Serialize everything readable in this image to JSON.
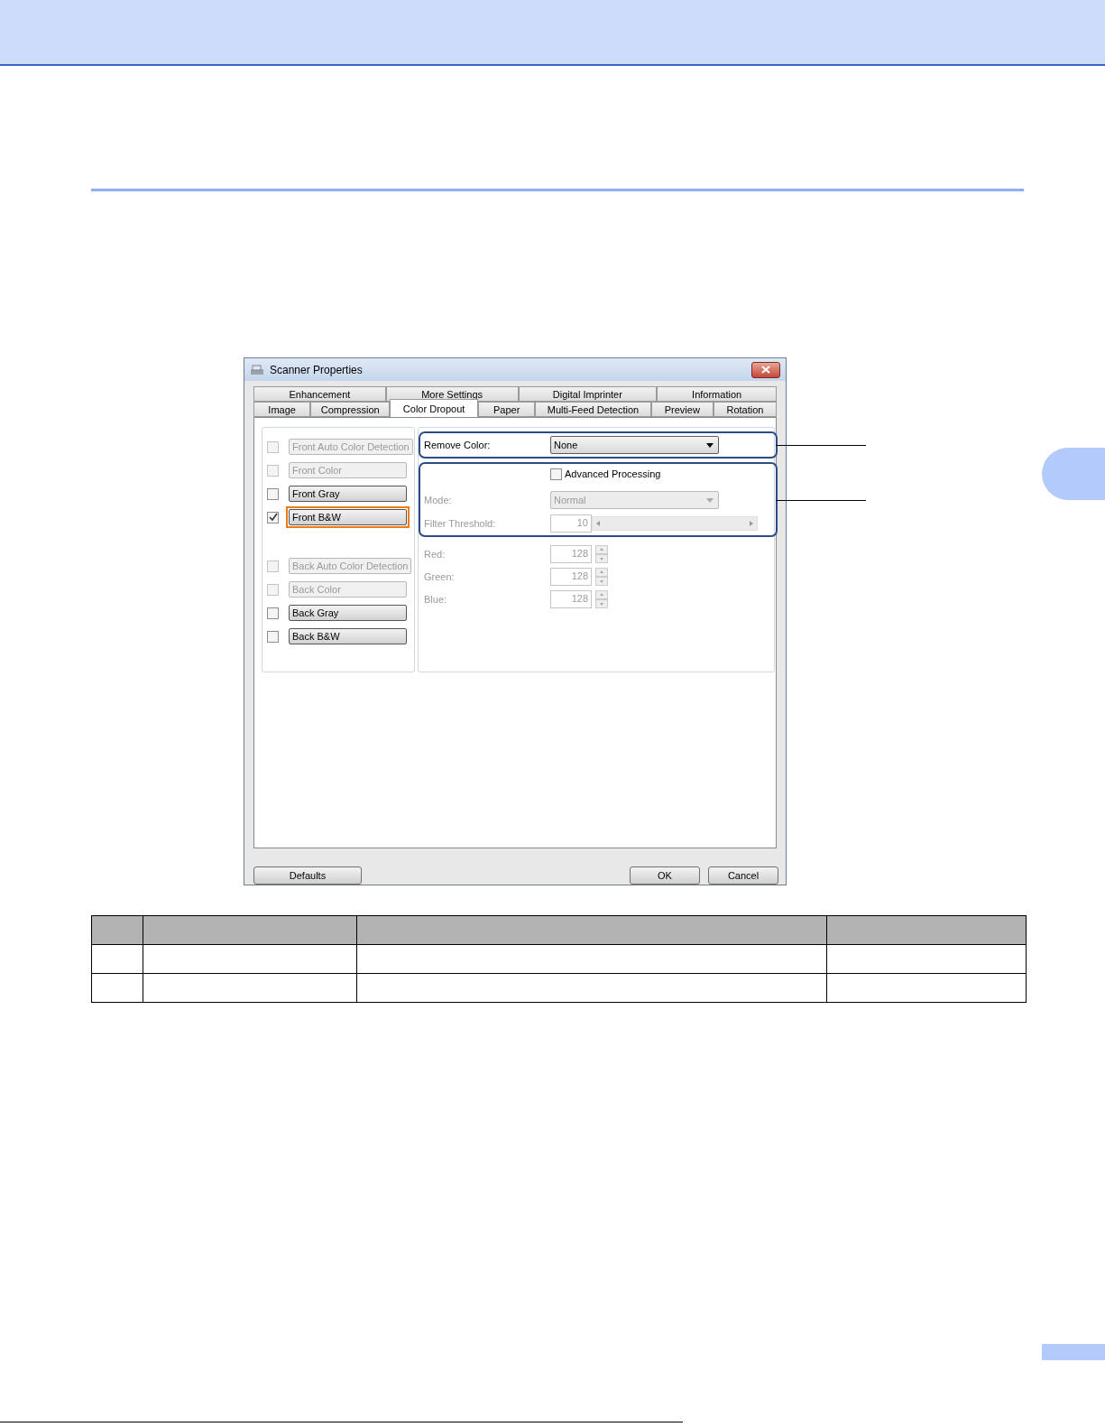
{
  "dialog": {
    "title": "Scanner Properties",
    "tab_rows": [
      [
        {
          "label": "Enhancement",
          "selected": false
        },
        {
          "label": "More Settings",
          "selected": false
        },
        {
          "label": "Digital Imprinter",
          "selected": false
        },
        {
          "label": "Information",
          "selected": false
        }
      ],
      [
        {
          "label": "Image",
          "selected": false
        },
        {
          "label": "Compression",
          "selected": false
        },
        {
          "label": "Color Dropout",
          "selected": true
        },
        {
          "label": "Paper",
          "selected": false
        },
        {
          "label": "Multi-Feed Detection",
          "selected": false
        },
        {
          "label": "Preview",
          "selected": false
        },
        {
          "label": "Rotation",
          "selected": false
        }
      ]
    ],
    "image_types": [
      {
        "label": "Front Auto Color Detection",
        "checked": false,
        "disabled": true,
        "highlighted": false
      },
      {
        "label": "Front Color",
        "checked": false,
        "disabled": true,
        "highlighted": false
      },
      {
        "label": "Front Gray",
        "checked": false,
        "disabled": false,
        "highlighted": false
      },
      {
        "label": "Front B&W",
        "checked": true,
        "disabled": false,
        "highlighted": true
      },
      {
        "label": "Back Auto Color Detection",
        "checked": false,
        "disabled": true,
        "highlighted": false
      },
      {
        "label": "Back Color",
        "checked": false,
        "disabled": true,
        "highlighted": false
      },
      {
        "label": "Back Gray",
        "checked": false,
        "disabled": false,
        "highlighted": false
      },
      {
        "label": "Back B&W",
        "checked": false,
        "disabled": false,
        "highlighted": false
      }
    ],
    "remove_color": {
      "label": "Remove Color:",
      "value": "None"
    },
    "advanced_processing": {
      "label": "Advanced Processing",
      "checked": false
    },
    "mode": {
      "label": "Mode:",
      "value": "Normal",
      "disabled": true
    },
    "filter_threshold": {
      "label": "Filter Threshold:",
      "value": "10",
      "disabled": true
    },
    "channels": [
      {
        "label": "Red:",
        "value": "128",
        "disabled": true
      },
      {
        "label": "Green:",
        "value": "128",
        "disabled": true
      },
      {
        "label": "Blue:",
        "value": "128",
        "disabled": true
      }
    ],
    "buttons": {
      "left": [
        "Defaults"
      ],
      "right": [
        "OK",
        "Cancel"
      ]
    }
  }
}
